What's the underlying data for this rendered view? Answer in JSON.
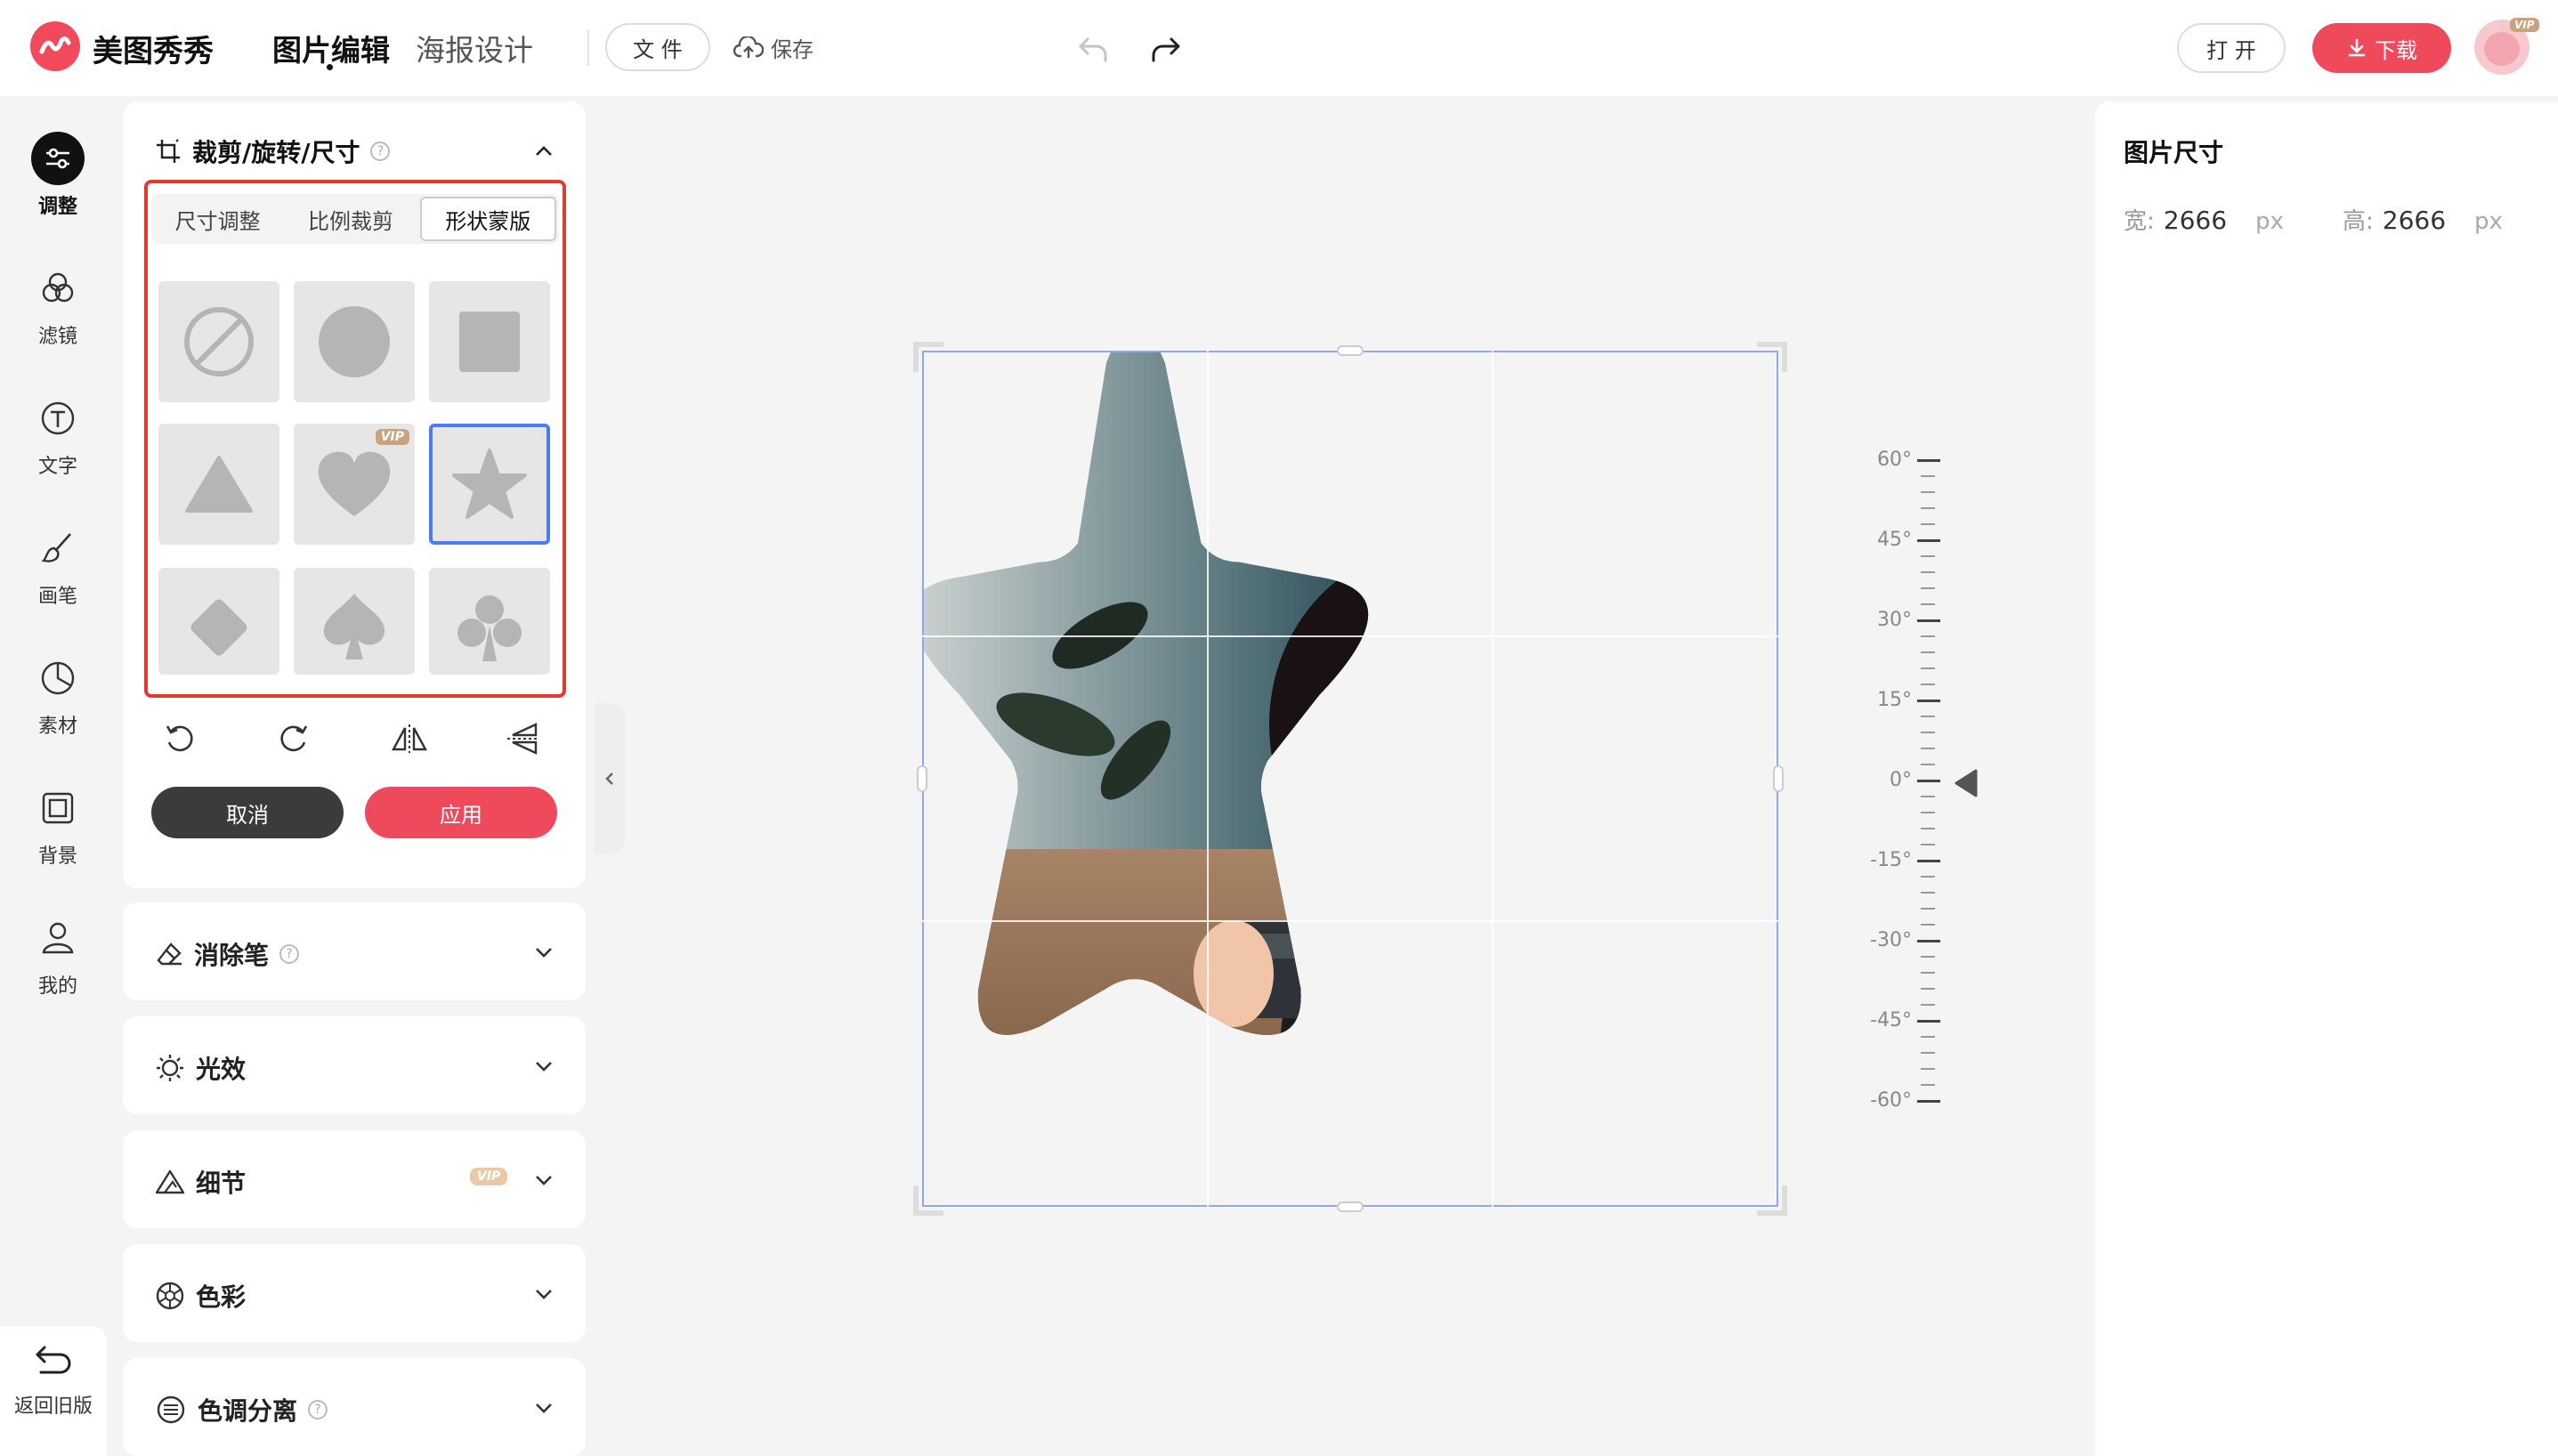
{
  "app": {
    "brand": "美图秀秀",
    "nav_edit": "图片编辑",
    "nav_poster": "海报设计",
    "file_label": "文 件",
    "save_label": "保存",
    "open_label": "打 开",
    "download_label": "下载",
    "avatar_badge": "VIP",
    "accent_color": "#ef4a5c"
  },
  "rail": {
    "items": [
      {
        "label": "调整",
        "icon": "adjust-icon"
      },
      {
        "label": "滤镜",
        "icon": "filter-icon"
      },
      {
        "label": "文字",
        "icon": "text-icon"
      },
      {
        "label": "画笔",
        "icon": "brush-icon"
      },
      {
        "label": "素材",
        "icon": "sticker-icon"
      },
      {
        "label": "背景",
        "icon": "background-icon"
      },
      {
        "label": "我的",
        "icon": "user-icon"
      }
    ],
    "back_old": "返回旧版"
  },
  "panel": {
    "title": "裁剪/旋转/尺寸",
    "tabs": [
      "尺寸调整",
      "比例裁剪",
      "形状蒙版"
    ],
    "active_tab": "形状蒙版",
    "shapes": [
      {
        "name": "none"
      },
      {
        "name": "circle"
      },
      {
        "name": "square"
      },
      {
        "name": "triangle"
      },
      {
        "name": "heart",
        "badge": "VIP"
      },
      {
        "name": "star",
        "selected": true
      },
      {
        "name": "diamond"
      },
      {
        "name": "spade"
      },
      {
        "name": "club"
      }
    ],
    "heart_badge": "VIP",
    "cancel_label": "取消",
    "apply_label": "应用"
  },
  "accordions": [
    {
      "title": "消除笔",
      "icon": "eraser-icon",
      "help": true
    },
    {
      "title": "光效",
      "icon": "light-icon"
    },
    {
      "title": "细节",
      "icon": "detail-icon",
      "badge": "VIP"
    },
    {
      "title": "色彩",
      "icon": "color-icon"
    },
    {
      "title": "色调分离",
      "icon": "split-tone-icon",
      "help": true
    }
  ],
  "ruler": {
    "labels": [
      "60°",
      "45°",
      "30°",
      "15°",
      "0°",
      "-15°",
      "-30°",
      "-45°",
      "-60°"
    ],
    "current": "0°"
  },
  "right_panel": {
    "title": "图片尺寸",
    "width_label": "宽:",
    "width_value": "2666",
    "height_label": "高:",
    "height_value": "2666",
    "unit": "px"
  }
}
